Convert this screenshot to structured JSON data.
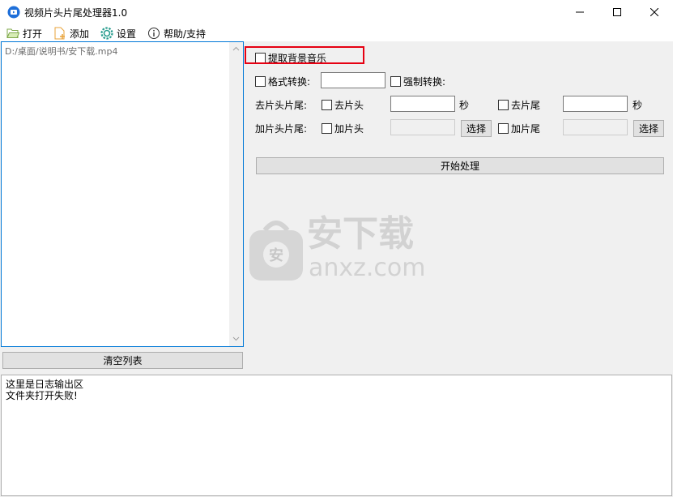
{
  "window": {
    "title": "视频片头片尾处理器1.0"
  },
  "menu": {
    "open": "打开",
    "add": "添加",
    "settings": "设置",
    "help": "帮助/支持"
  },
  "file_list": {
    "items": [
      "D:/桌面/说明书/安下载.mp4"
    ]
  },
  "clear_button": "清空列表",
  "options": {
    "extract_bgm": "提取背景音乐",
    "format_convert": "格式转换:",
    "force_convert": "强制转换:",
    "trim_label": "去片头片尾:",
    "trim_head": "去片头",
    "trim_tail": "去片尾",
    "seconds": "秒",
    "add_label": "加片头片尾:",
    "add_head": "加片头",
    "add_tail": "加片尾",
    "select": "选择",
    "start": "开始处理"
  },
  "watermark": {
    "text": "安下载",
    "url": "anxz.com"
  },
  "log": {
    "lines": [
      "这里是日志输出区",
      "文件夹打开失败!"
    ]
  },
  "colors": {
    "highlight": "#e60012",
    "accent": "#0078d7"
  }
}
